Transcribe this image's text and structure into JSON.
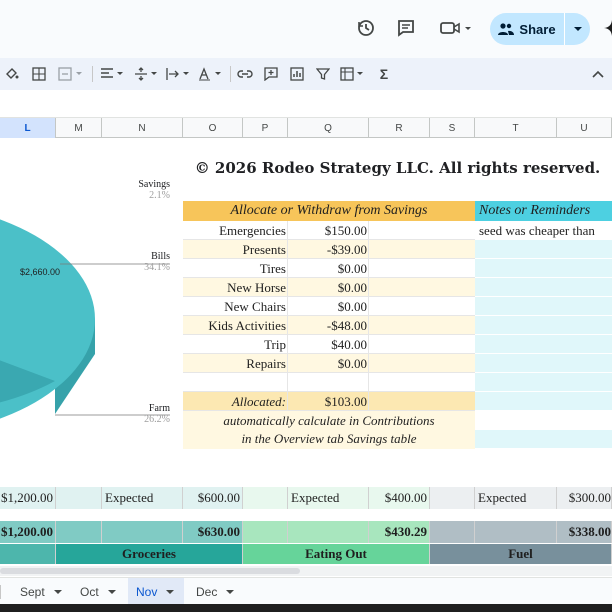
{
  "header": {
    "share_label": "Share"
  },
  "columns": [
    "L",
    "M",
    "N",
    "O",
    "P",
    "Q",
    "R",
    "S",
    "T",
    "U"
  ],
  "selected_column": "L",
  "sheet": {
    "copyright": "© 2026 Rodeo Strategy LLC. All rights reserved.",
    "pie": {
      "center_label": "$2,660.00",
      "labels": [
        {
          "name": "Savings",
          "pct": "2.1%"
        },
        {
          "name": "Bills",
          "pct": "34.1%"
        },
        {
          "name": "Farm",
          "pct": "26.2%"
        }
      ]
    },
    "savings_table": {
      "header": "Allocate or Withdraw from Savings",
      "notes_header": "Notes or Reminders",
      "rows": [
        {
          "label": "Emergencies",
          "value": "$150.00",
          "note": "seed was cheaper than"
        },
        {
          "label": "Presents",
          "value": "-$39.00",
          "note": ""
        },
        {
          "label": "Tires",
          "value": "$0.00",
          "note": ""
        },
        {
          "label": "New Horse",
          "value": "$0.00",
          "note": ""
        },
        {
          "label": "New Chairs",
          "value": "$0.00",
          "note": ""
        },
        {
          "label": "Kids Activities",
          "value": "-$48.00",
          "note": ""
        },
        {
          "label": "Trip",
          "value": "$40.00",
          "note": ""
        },
        {
          "label": "Repairs",
          "value": "$0.00",
          "note": ""
        }
      ],
      "allocated_label": "Allocated:",
      "allocated_value": "$103.00",
      "info_line1": "automatically calculate in Contributions",
      "info_line2": "in the Overview tab Savings table"
    },
    "expected_row": {
      "left_value": "$1,200.00",
      "groups": [
        {
          "label": "Expected",
          "value": "$600.00"
        },
        {
          "label": "Expected",
          "value": "$400.00"
        },
        {
          "label": "Expected",
          "value": "$300.00"
        }
      ]
    },
    "actual_row": {
      "left_value": "$1,200.00",
      "values": [
        "$630.00",
        "$430.29",
        "$338.00"
      ]
    },
    "category_row": [
      "Groceries",
      "Eating Out",
      "Fuel"
    ]
  },
  "tabs": [
    {
      "label": "Sept"
    },
    {
      "label": "Oct"
    },
    {
      "label": "Nov"
    },
    {
      "label": "Dec"
    }
  ],
  "active_tab": "Nov",
  "colors": {
    "accent": "#c2e7ff",
    "table_header": "#f7c55a",
    "notes_header": "#4dd0e1",
    "teal_pie": "#4bc0c8",
    "groceries": "#26a69a",
    "eating_out": "#66d49a",
    "fuel": "#78909c"
  }
}
